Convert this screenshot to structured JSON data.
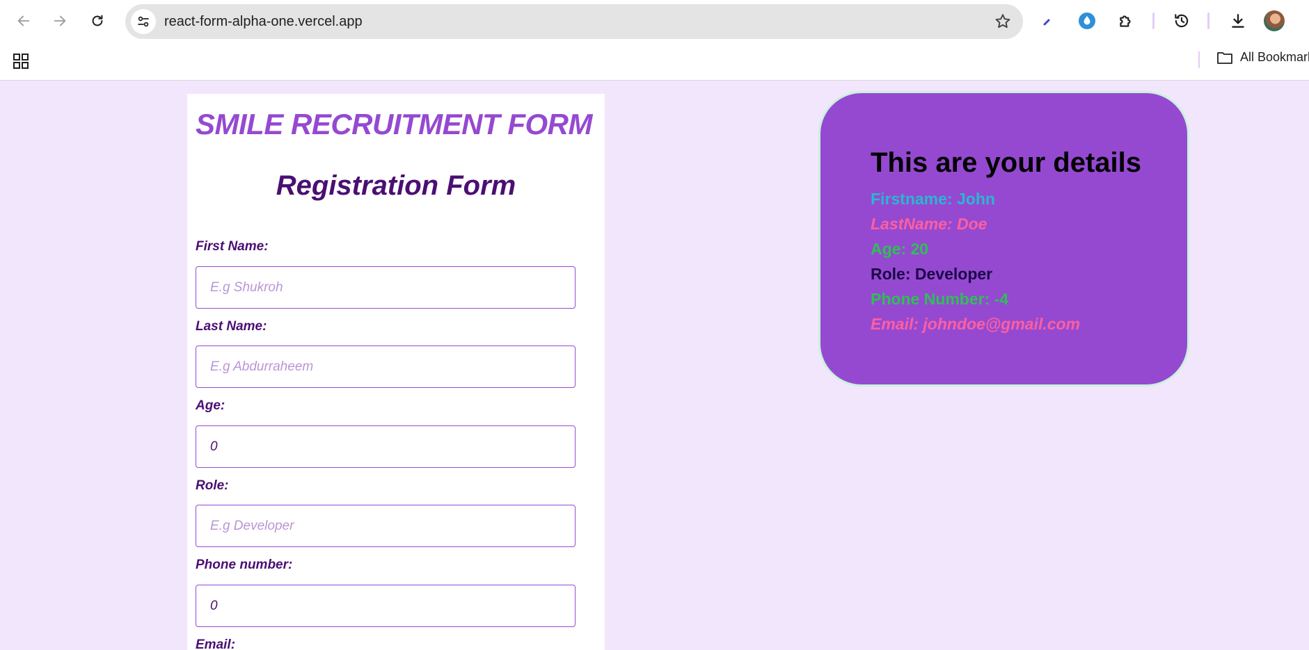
{
  "browser": {
    "url": "react-form-alpha-one.vercel.app",
    "bookmarks_label": "All Bookmarks",
    "icons": [
      "back-arrow-icon",
      "forward-arrow-icon",
      "reload-icon",
      "site-info-icon",
      "star-icon",
      "pen-extension-icon",
      "extension-drop-icon",
      "puzzle-icon",
      "history-icon",
      "download-icon",
      "apps-grid-icon",
      "folder-icon"
    ]
  },
  "form": {
    "brand_title": "SMILE RECRUITMENT FORM",
    "title": "Registration Form",
    "fields": [
      {
        "label": "First Name:",
        "placeholder": "E.g Shukroh",
        "value": ""
      },
      {
        "label": "Last Name:",
        "placeholder": "E.g Abdurraheem",
        "value": ""
      },
      {
        "label": "Age:",
        "placeholder": "",
        "value": "0"
      },
      {
        "label": "Role:",
        "placeholder": "E.g Developer",
        "value": ""
      },
      {
        "label": "Phone number:",
        "placeholder": "",
        "value": "0"
      },
      {
        "label": "Email:",
        "placeholder": "",
        "value": ""
      }
    ]
  },
  "details": {
    "title": "This are your details",
    "lines": [
      {
        "text": "Firstname: John",
        "color": "#2ab7cf",
        "italic": false
      },
      {
        "text": "LastName: Doe",
        "color": "#ff5fa0",
        "italic": true
      },
      {
        "text": "Age: 20",
        "color": "#2fbf56",
        "italic": false
      },
      {
        "text": "Role: Developer",
        "color": "#1c0648",
        "italic": false
      },
      {
        "text": "Phone Number: -4",
        "color": "#2fbf56",
        "italic": false
      },
      {
        "text": "Email: johndoe@gmail.com",
        "color": "#ff5fa0",
        "italic": true
      }
    ]
  },
  "colors": {
    "page_bg": "#f2e6fd",
    "brand_purple": "#9549d1",
    "dark_purple": "#4a0f73",
    "card_border": "#c9f1dd"
  }
}
